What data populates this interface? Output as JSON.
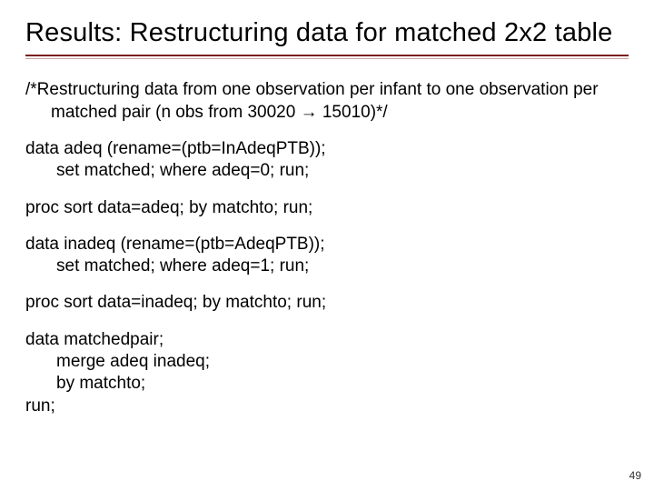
{
  "slide": {
    "title": "Results: Restructuring data for matched 2x2 table",
    "page_number": "49"
  },
  "body": {
    "comment": "/*Restructuring data from one observation per infant to one observation per matched pair (n obs from 30020 → 15010)*/",
    "block1": {
      "l1": "data adeq (rename=(ptb=InAdeqPTB));",
      "l2": "set matched; where adeq=0; run;"
    },
    "block2": "proc sort data=adeq; by matchto; run;",
    "block3": {
      "l1": "data inadeq (rename=(ptb=AdeqPTB));",
      "l2": "set matched; where adeq=1; run;"
    },
    "block4": "proc sort data=inadeq; by matchto; run;",
    "block5": {
      "l1": "data matchedpair;",
      "l2": "merge adeq inadeq;",
      "l3": "by matchto;",
      "l4": "run;"
    }
  }
}
